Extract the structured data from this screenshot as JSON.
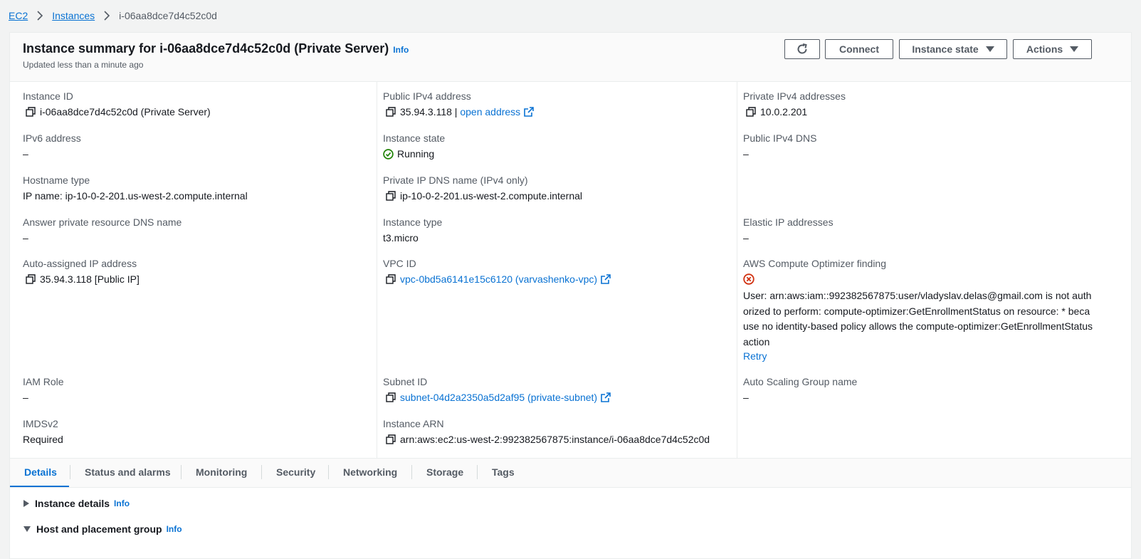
{
  "breadcrumb": {
    "ec2": "EC2",
    "instances": "Instances",
    "current": "i-06aa8dce7d4c52c0d"
  },
  "header": {
    "title": "Instance summary for i-06aa8dce7d4c52c0d (Private Server)",
    "info": "Info",
    "updated": "Updated less than a minute ago",
    "connect": "Connect",
    "instance_state": "Instance state",
    "actions": "Actions"
  },
  "fields": {
    "instance_id": {
      "label": "Instance ID",
      "value": "i-06aa8dce7d4c52c0d (Private Server)"
    },
    "public_ipv4": {
      "label": "Public IPv4 address",
      "value": "35.94.3.118 | ",
      "link": "open address"
    },
    "private_ipv4": {
      "label": "Private IPv4 addresses",
      "value": "10.0.2.201"
    },
    "ipv6": {
      "label": "IPv6 address",
      "value": "–"
    },
    "instance_state": {
      "label": "Instance state",
      "value": "Running"
    },
    "public_dns": {
      "label": "Public IPv4 DNS",
      "value": "–"
    },
    "hostname_type": {
      "label": "Hostname type",
      "value": "IP name: ip-10-0-2-201.us-west-2.compute.internal"
    },
    "private_dns": {
      "label": "Private IP DNS name (IPv4 only)",
      "value": "ip-10-0-2-201.us-west-2.compute.internal"
    },
    "answer_dns": {
      "label": "Answer private resource DNS name",
      "value": "–"
    },
    "instance_type": {
      "label": "Instance type",
      "value": "t3.micro"
    },
    "elastic_ip": {
      "label": "Elastic IP addresses",
      "value": "–"
    },
    "auto_ip": {
      "label": "Auto-assigned IP address",
      "value": "35.94.3.118 [Public IP]"
    },
    "vpc_id": {
      "label": "VPC ID",
      "value": "vpc-0bd5a6141e15c6120 (varvashenko-vpc)"
    },
    "optimizer": {
      "label": "AWS Compute Optimizer finding",
      "error": "User: arn:aws:iam::992382567875:user/vladyslav.delas@gmail.com is not authorized to perform: compute-optimizer:GetEnrollmentStatus on resource: * because no identity-based policy allows the compute-optimizer:GetEnrollmentStatus action",
      "retry": "Retry"
    },
    "iam_role": {
      "label": "IAM Role",
      "value": "–"
    },
    "subnet_id": {
      "label": "Subnet ID",
      "value": "subnet-04d2a2350a5d2af95 (private-subnet)"
    },
    "asg_name": {
      "label": "Auto Scaling Group name",
      "value": "–"
    },
    "imdsv2": {
      "label": "IMDSv2",
      "value": "Required"
    },
    "instance_arn": {
      "label": "Instance ARN",
      "value": "arn:aws:ec2:us-west-2:992382567875:instance/i-06aa8dce7d4c52c0d"
    }
  },
  "tabs": [
    "Details",
    "Status and alarms",
    "Monitoring",
    "Security",
    "Networking",
    "Storage",
    "Tags"
  ],
  "sections": {
    "instance_details": "Instance details",
    "host_placement": "Host and placement group",
    "info": "Info"
  },
  "colors": {
    "link": "#0972d3",
    "running": "#1d8102",
    "error": "#d13212"
  }
}
